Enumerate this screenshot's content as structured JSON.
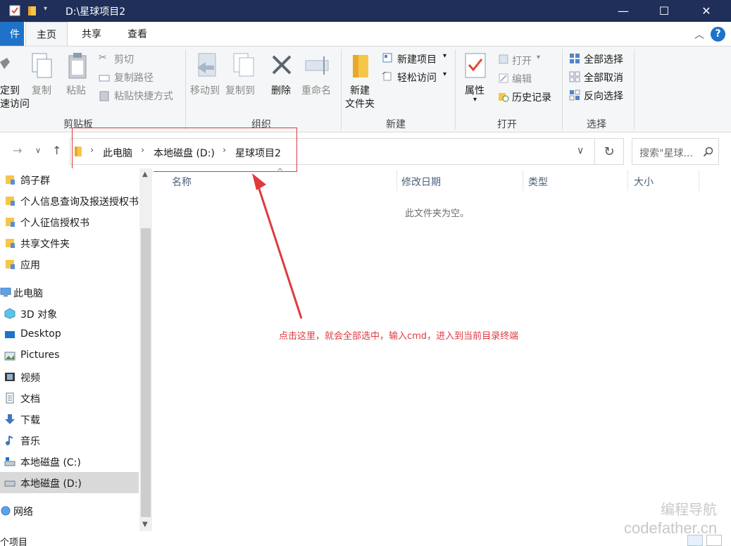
{
  "window": {
    "title": "D:\\星球项目2",
    "buttons": {
      "minimize": "—",
      "maximize": "☐",
      "close": "✕"
    }
  },
  "ribbon_tabs": {
    "file": "件",
    "home": "主页",
    "share": "共享",
    "view": "查看",
    "help": "?"
  },
  "ribbon": {
    "clipboard": {
      "label": "剪贴板",
      "pin_line1": "定到",
      "pin_line2": "速访问",
      "copy": "复制",
      "paste": "粘贴",
      "cut": "剪切",
      "copy_path": "复制路径",
      "paste_shortcut": "粘贴快捷方式"
    },
    "organize": {
      "label": "组织",
      "move_to": "移动到",
      "copy_to": "复制到",
      "delete": "删除",
      "rename": "重命名"
    },
    "new": {
      "label": "新建",
      "new_folder_line1": "新建",
      "new_folder_line2": "文件夹",
      "new_item": "新建项目",
      "easy_access": "轻松访问"
    },
    "open": {
      "label": "打开",
      "properties": "属性",
      "open": "打开",
      "edit": "编辑",
      "history": "历史记录"
    },
    "select": {
      "label": "选择",
      "select_all": "全部选择",
      "select_none": "全部取消",
      "invert": "反向选择"
    }
  },
  "address": {
    "crumbs": [
      "此电脑",
      "本地磁盘 (D:)",
      "星球项目2"
    ],
    "search_placeholder": "搜索\"星球..."
  },
  "nav_pane": {
    "items": [
      {
        "label": "鸽子群",
        "icon": "pinned-folder-icon"
      },
      {
        "label": "个人信息查询及报送授权书",
        "icon": "pinned-folder-icon"
      },
      {
        "label": "个人征信授权书",
        "icon": "pinned-folder-icon"
      },
      {
        "label": "共享文件夹",
        "icon": "pinned-folder-icon"
      },
      {
        "label": "应用",
        "icon": "pinned-folder-icon"
      },
      {
        "label": "此电脑",
        "icon": "this-pc-icon"
      },
      {
        "label": "3D 对象",
        "icon": "3d-objects-icon"
      },
      {
        "label": "Desktop",
        "icon": "desktop-icon"
      },
      {
        "label": "Pictures",
        "icon": "pictures-icon"
      },
      {
        "label": "视频",
        "icon": "videos-icon"
      },
      {
        "label": "文档",
        "icon": "documents-icon"
      },
      {
        "label": "下载",
        "icon": "downloads-icon"
      },
      {
        "label": "音乐",
        "icon": "music-icon"
      },
      {
        "label": "本地磁盘 (C:)",
        "icon": "drive-c-icon"
      },
      {
        "label": "本地磁盘 (D:)",
        "icon": "drive-d-icon",
        "selected": true
      },
      {
        "label": "网络",
        "icon": "network-icon"
      }
    ]
  },
  "content": {
    "columns": [
      "名称",
      "修改日期",
      "类型",
      "大小"
    ],
    "empty_message": "此文件夹为空。"
  },
  "annotation": "点击这里，就会全部选中，输入cmd，进入到当前目录终端",
  "status": {
    "text": "个项目"
  },
  "watermark": {
    "line1": "编程导航",
    "line2": "codefather.cn"
  },
  "colors": {
    "titlebar": "#1f2f5a",
    "accent": "#1e73c9",
    "annotation_red": "#e0393e",
    "ribbon_bg": "#f5f6f7"
  }
}
